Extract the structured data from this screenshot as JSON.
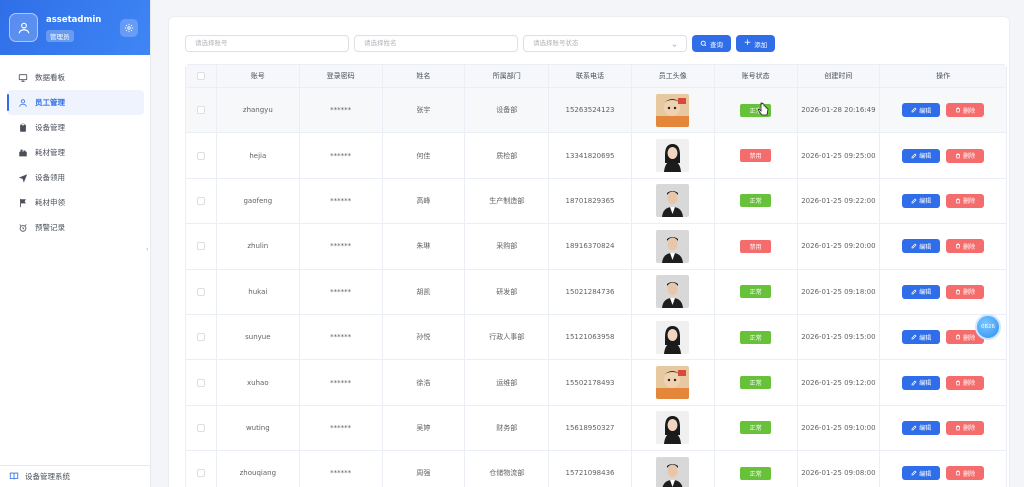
{
  "sidebar": {
    "username": "assetadmin",
    "role": "管理员",
    "items": [
      {
        "label": "数据看板",
        "icon": "monitor-icon"
      },
      {
        "label": "员工管理",
        "icon": "user-icon",
        "active": true
      },
      {
        "label": "设备管理",
        "icon": "clipboard-icon"
      },
      {
        "label": "耗材管理",
        "icon": "box-icon"
      },
      {
        "label": "设备领用",
        "icon": "send-icon"
      },
      {
        "label": "耗材申领",
        "icon": "flag-icon"
      },
      {
        "label": "预警记录",
        "icon": "alarm-icon"
      }
    ],
    "footer": "设备管理系统"
  },
  "filters": {
    "account_placeholder": "请选择账号",
    "name_placeholder": "请选择姓名",
    "status_placeholder": "请选择账号状态",
    "search_label": "查询",
    "add_label": "添加"
  },
  "table": {
    "headers": [
      "账号",
      "登录密码",
      "姓名",
      "所属部门",
      "联系电话",
      "员工头像",
      "账号状态",
      "创建时间",
      "操作"
    ],
    "edit_label": "编辑",
    "delete_label": "删除",
    "rows": [
      {
        "account": "zhangyu",
        "password": "******",
        "name": "张宇",
        "dept": "设备部",
        "phone": "15263524123",
        "status": "正常",
        "status_ok": true,
        "created": "2026-01-28 20:16:49",
        "photo": "cartoon-avatar-icon"
      },
      {
        "account": "hejia",
        "password": "******",
        "name": "何佳",
        "dept": "质检部",
        "phone": "13341820695",
        "status": "禁用",
        "status_ok": false,
        "created": "2026-01-25 09:25:00",
        "photo": "female-portrait-icon"
      },
      {
        "account": "gaofeng",
        "password": "******",
        "name": "高峰",
        "dept": "生产制造部",
        "phone": "18701829365",
        "status": "正常",
        "status_ok": true,
        "created": "2026-01-25 09:22:00",
        "photo": "male-portrait-icon"
      },
      {
        "account": "zhulin",
        "password": "******",
        "name": "朱琳",
        "dept": "采购部",
        "phone": "18916370824",
        "status": "禁用",
        "status_ok": false,
        "created": "2026-01-25 09:20:00",
        "photo": "male-portrait-icon"
      },
      {
        "account": "hukai",
        "password": "******",
        "name": "胡凯",
        "dept": "研发部",
        "phone": "15021284736",
        "status": "正常",
        "status_ok": true,
        "created": "2026-01-25 09:18:00",
        "photo": "male-portrait-icon"
      },
      {
        "account": "sunyue",
        "password": "******",
        "name": "孙悦",
        "dept": "行政人事部",
        "phone": "15121063958",
        "status": "正常",
        "status_ok": true,
        "created": "2026-01-25 09:15:00",
        "photo": "female-portrait-icon"
      },
      {
        "account": "xuhao",
        "password": "******",
        "name": "徐浩",
        "dept": "运维部",
        "phone": "15502178493",
        "status": "正常",
        "status_ok": true,
        "created": "2026-01-25 09:12:00",
        "photo": "cartoon-avatar-icon"
      },
      {
        "account": "wuting",
        "password": "******",
        "name": "吴婷",
        "dept": "财务部",
        "phone": "15618950327",
        "status": "正常",
        "status_ok": true,
        "created": "2026-01-25 09:10:00",
        "photo": "female-portrait-icon"
      },
      {
        "account": "zhouqiang",
        "password": "******",
        "name": "周强",
        "dept": "仓储物流部",
        "phone": "15721098436",
        "status": "正常",
        "status_ok": true,
        "created": "2026-01-25 09:08:00",
        "photo": "male-portrait-icon"
      }
    ]
  },
  "floating_badge": "0826",
  "colors": {
    "primary": "#2f6ee8",
    "success": "#67c23a",
    "danger": "#f56c6c"
  }
}
